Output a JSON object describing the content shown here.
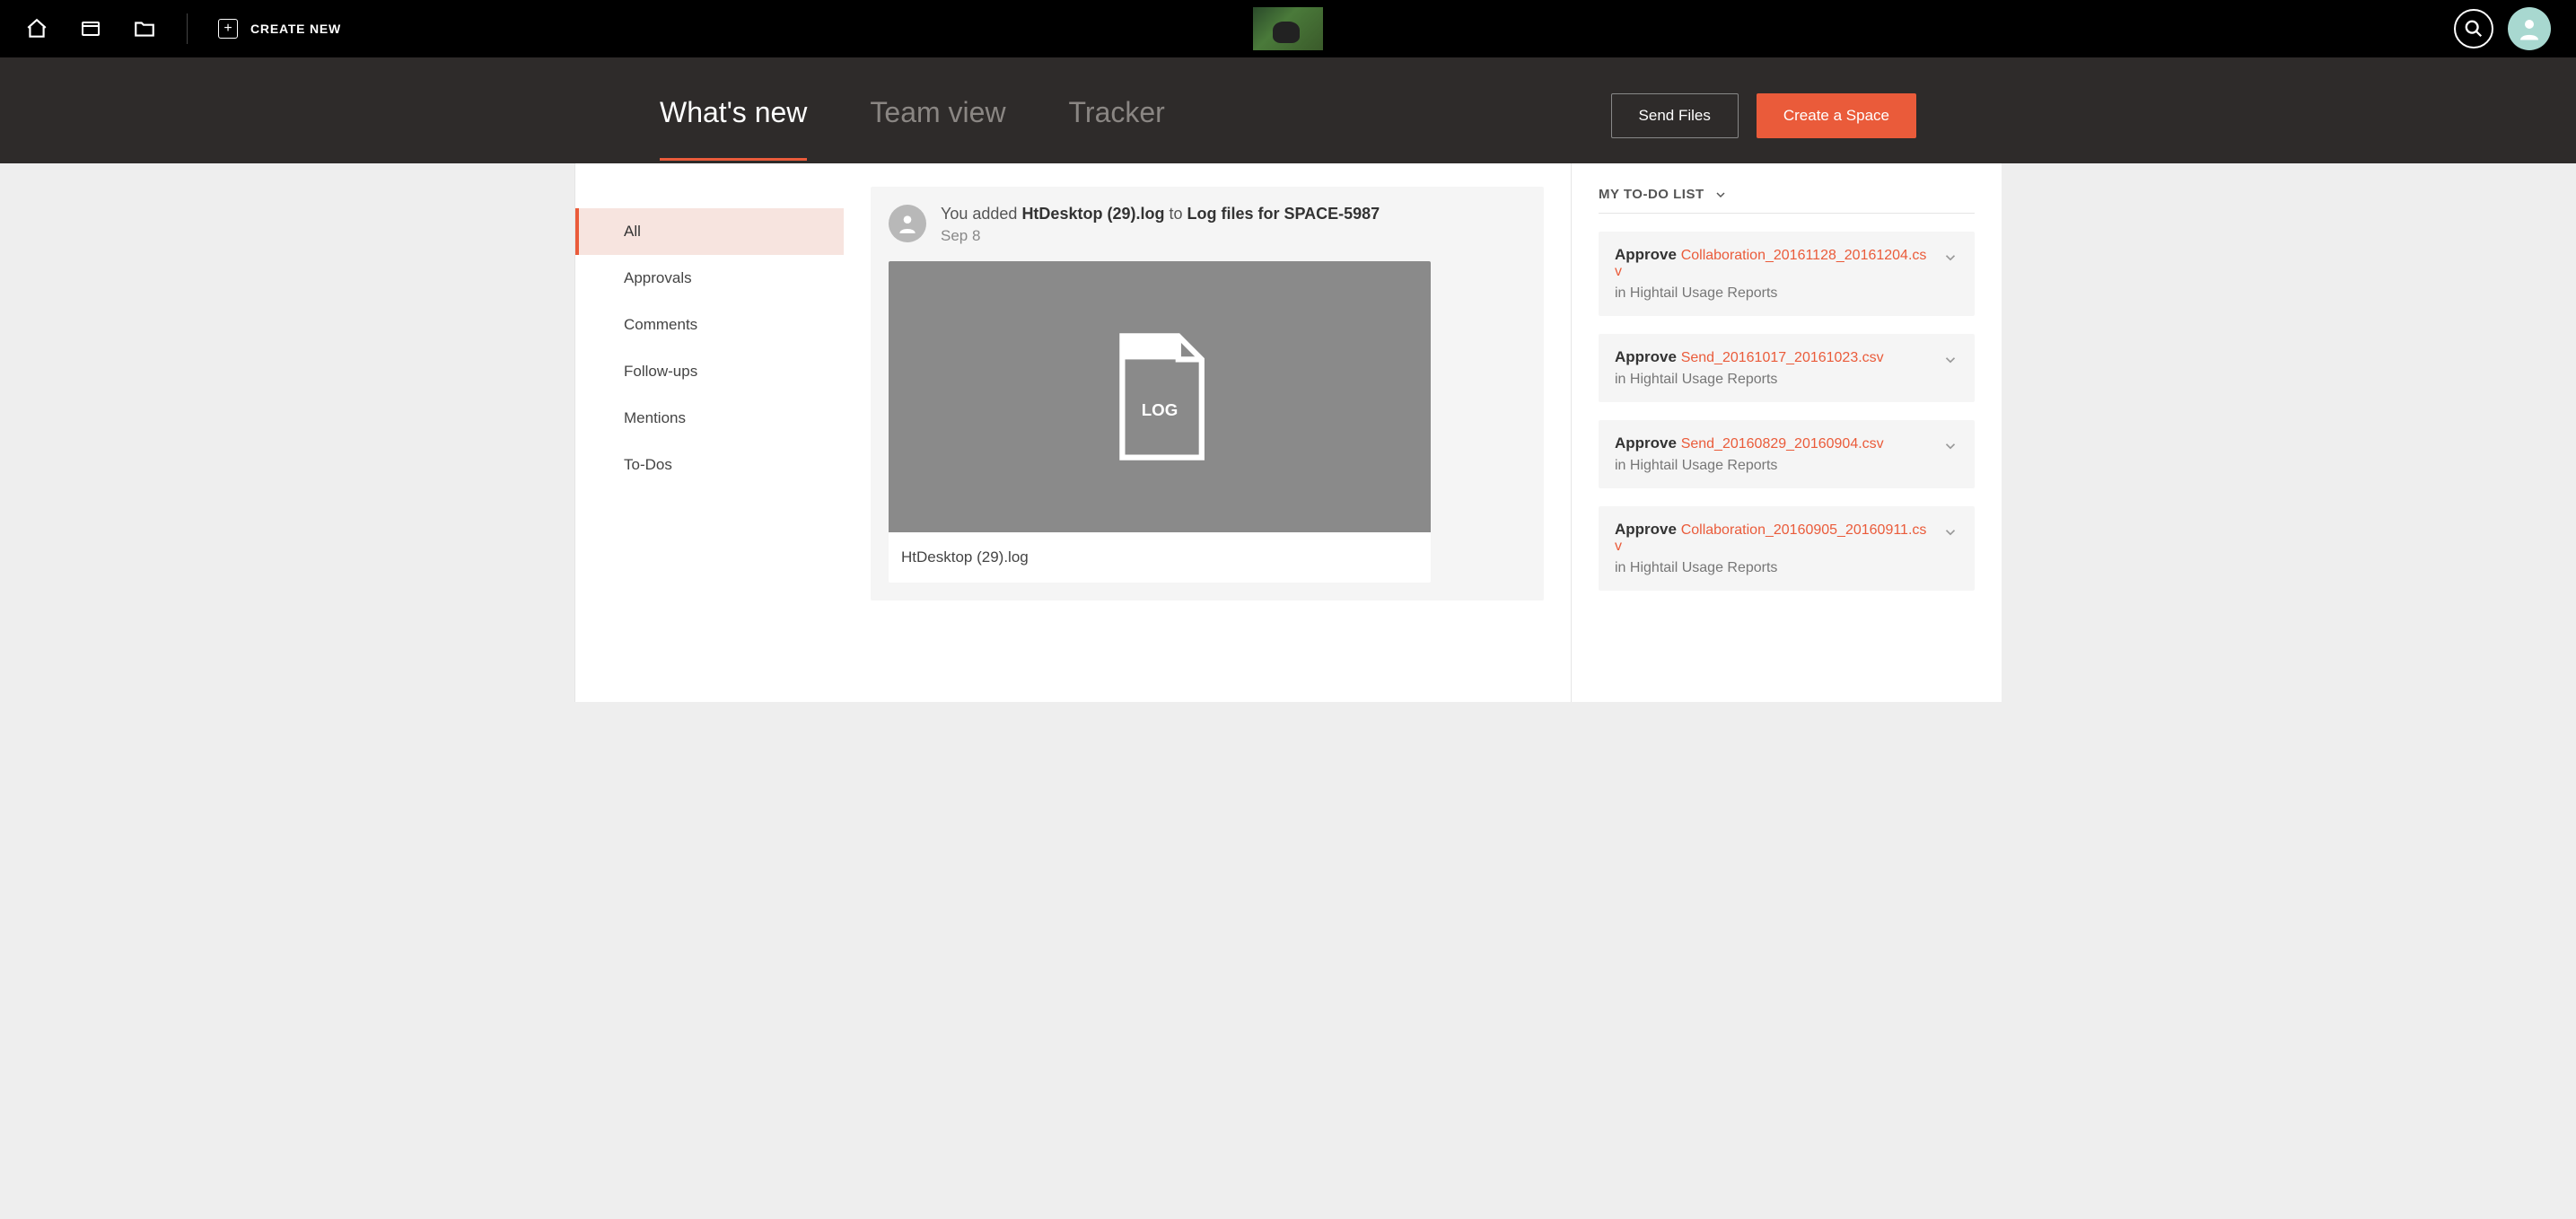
{
  "topbar": {
    "create_label": "CREATE NEW"
  },
  "subheader": {
    "tabs": [
      {
        "label": "What's new",
        "active": true
      },
      {
        "label": "Team view",
        "active": false
      },
      {
        "label": "Tracker",
        "active": false
      }
    ],
    "send_files": "Send Files",
    "create_space": "Create a Space"
  },
  "sidebar": {
    "items": [
      {
        "label": "All",
        "active": true
      },
      {
        "label": "Approvals",
        "active": false
      },
      {
        "label": "Comments",
        "active": false
      },
      {
        "label": "Follow-ups",
        "active": false
      },
      {
        "label": "Mentions",
        "active": false
      },
      {
        "label": "To-Dos",
        "active": false
      }
    ]
  },
  "feed": {
    "prefix": "You added ",
    "file": "HtDesktop (29).log",
    "mid": " to ",
    "dest": "Log files for SPACE-5987",
    "date": "Sep 8",
    "thumb_badge": "LOG",
    "file_label": "HtDesktop (29).log"
  },
  "todo": {
    "header": "MY TO-DO LIST",
    "in_prefix": "in ",
    "items": [
      {
        "action": "Approve ",
        "link": "Collaboration_20161128_20161204.csv",
        "location": "Hightail Usage Reports"
      },
      {
        "action": "Approve ",
        "link": "Send_20161017_20161023.csv",
        "location": "Hightail Usage Reports"
      },
      {
        "action": "Approve ",
        "link": "Send_20160829_20160904.csv",
        "location": "Hightail Usage Reports"
      },
      {
        "action": "Approve ",
        "link": "Collaboration_20160905_20160911.csv",
        "location": "Hightail Usage Reports"
      }
    ]
  }
}
